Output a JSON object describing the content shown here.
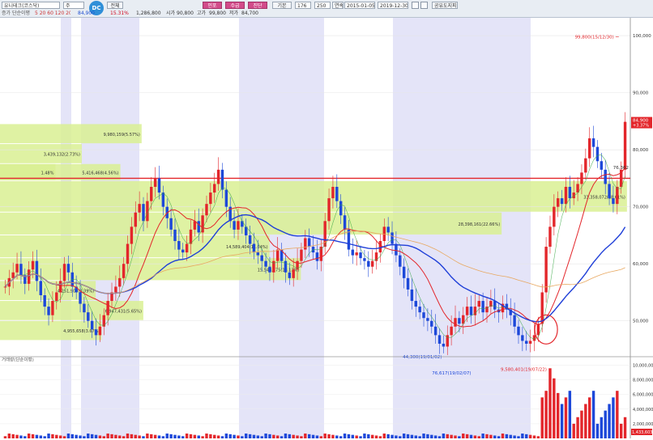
{
  "toolbar": {
    "title": "유니테크(코스닥)",
    "mode": "주",
    "price_label": "84,900",
    "change": "15.31%",
    "open": "1,286,800",
    "open_label": "시가",
    "high": "90,800",
    "high_label": "고가",
    "low_val": "99,800",
    "low_label": "저가",
    "prev": "84,700",
    "qty1": "176",
    "qty2": "250",
    "period_label": "연속",
    "start_date": "2015-01-05",
    "end_date": "2019-12-30",
    "tab1": "전체",
    "tab2": "인포",
    "tab3": "수급",
    "tab4": "진단",
    "tab5": "기본",
    "right_btn": "공유도지피",
    "sub_label": "증가 단순이평",
    "sub_values": "5 20 60 120 200 250"
  },
  "chart_data": [
    {
      "type": "candlestick",
      "title": "",
      "y_axis_ticks": [
        50000,
        60000,
        70000,
        80000,
        90000,
        100000
      ],
      "y_tick_labels": [
        "50,000",
        "60,000",
        "70,000",
        "80,000",
        "90,000",
        "100,000"
      ],
      "ylim": [
        45000,
        102000
      ],
      "current_price": "84,900",
      "current_change": "+3.37%",
      "annotations": [
        {
          "text": "99,800(15/12/30)",
          "value": 99800
        },
        {
          "text": "44,300(19/01/02)",
          "value": 44300
        },
        {
          "text": "76,362",
          "value": 76362
        }
      ],
      "volume_profile": [
        {
          "label": "9,980,159(5.57%)",
          "price_low": 81000,
          "price_high": 84500,
          "pct": 5.57
        },
        {
          "label": "3,439,132(2.73%)",
          "price_low": 77500,
          "price_high": 81000,
          "pct": 2.73
        },
        {
          "label": "1.48%",
          "price_low": 74500,
          "price_high": 77500,
          "pct": 1.48
        },
        {
          "label": "5,416,468(4.56%)",
          "price_low": 74500,
          "price_high": 77500,
          "pct": 4.56
        },
        {
          "label": "33,358,072(28.61%)",
          "price_low": 69000,
          "price_high": 74500,
          "pct": 28.61
        },
        {
          "label": "28,398,161(22.66%)",
          "price_low": 65000,
          "price_high": 69000,
          "pct": 22.66
        },
        {
          "label": "14,589,404(11.64%)",
          "price_low": 61000,
          "price_high": 65000,
          "pct": 11.64
        },
        {
          "label": "15,548,275(13.13%)",
          "price_low": 57000,
          "price_high": 61000,
          "pct": 13.13
        },
        {
          "label": "4,251,909(3.39%)",
          "price_low": 53500,
          "price_high": 57000,
          "pct": 3.39
        },
        {
          "label": "6,947,431(5.65%)",
          "price_low": 50000,
          "price_high": 53500,
          "pct": 5.65
        },
        {
          "label": "4,955,658(3.67%)",
          "price_low": 46500,
          "price_high": 50000,
          "pct": 3.67
        }
      ],
      "horizontal_line": 75000,
      "closes": [
        56000,
        57500,
        58500,
        60000,
        58000,
        56500,
        59000,
        60500,
        57000,
        54500,
        52500,
        51000,
        53500,
        55000,
        57000,
        60000,
        58500,
        56000,
        55000,
        53000,
        51500,
        50000,
        48500,
        47500,
        49000,
        51000,
        53500,
        55000,
        56000,
        57500,
        60000,
        63500,
        66500,
        69000,
        70500,
        67500,
        71000,
        73500,
        75000,
        72500,
        70000,
        68000,
        66000,
        64000,
        62500,
        62000,
        63500,
        66000,
        67500,
        65500,
        68500,
        70500,
        72500,
        74000,
        76500,
        73000,
        70000,
        67500,
        66000,
        67500,
        66500,
        65000,
        63500,
        62000,
        61500,
        60500,
        59500,
        58500,
        60500,
        62500,
        60500,
        58500,
        57500,
        59000,
        60500,
        62500,
        64500,
        63000,
        62000,
        60500,
        63000,
        67500,
        71500,
        73500,
        71000,
        68500,
        66000,
        62500,
        61500,
        62000,
        61000,
        60500,
        59500,
        60500,
        62000,
        64000,
        66500,
        65500,
        63500,
        61500,
        59500,
        57500,
        55500,
        53500,
        52500,
        51500,
        50500,
        50000,
        49000,
        47500,
        46000,
        45500,
        47500,
        49000,
        50500,
        49500,
        51000,
        52500,
        51000,
        52500,
        53500,
        51500,
        52500,
        53500,
        52000,
        51500,
        53000,
        52000,
        51000,
        49000,
        47500,
        46500,
        46000,
        46500,
        47500,
        49500,
        55000,
        63000,
        66500,
        70000,
        71500,
        70500,
        73500,
        71500,
        72500,
        74000,
        76000,
        78500,
        82000,
        80500,
        78000,
        76500,
        74000,
        71500,
        70500,
        73500,
        76500,
        84900
      ],
      "ma_short": "red",
      "ma_long": "blue"
    },
    {
      "type": "bar",
      "title": "",
      "sub_label": "거래량(단순이평)",
      "y_tick_labels": [
        "2,000,000",
        "4,000,000",
        "6,000,000",
        "8,000,000",
        "10,000,000"
      ],
      "ylim": [
        0,
        10500000
      ],
      "annotations": [
        {
          "text": "76,617(19/02/07)"
        },
        {
          "text": "9,580,401(19/07/22)",
          "value": 9580401
        }
      ],
      "last_value": "1,433,603"
    }
  ],
  "colors": {
    "up": "#e3262b",
    "down": "#1d48d9",
    "profile": "#d9f093",
    "shade": "#e4e4f8",
    "ma20": "#e3262b",
    "ma60": "#1f3fd8",
    "ma120": "#e8a860"
  }
}
